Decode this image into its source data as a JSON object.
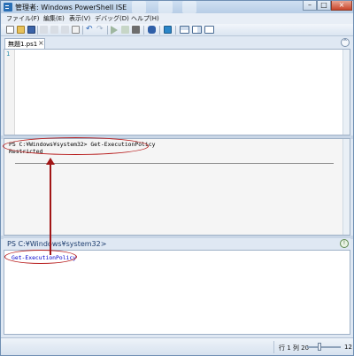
{
  "window": {
    "title": "管理者: Windows PowerShell ISE"
  },
  "menu": [
    "ファイル(F)",
    "編集(E)",
    "表示(V)",
    "デバッグ(D)",
    "ヘルプ(H)"
  ],
  "toolbar": {
    "icons": [
      "new-icon",
      "open-icon",
      "save-icon",
      "cut-icon",
      "copy-icon",
      "paste-icon",
      "clear-icon",
      "undo-icon",
      "redo-icon",
      "run-icon",
      "run-selection-icon",
      "stop-icon",
      "remote-icon",
      "powershell-icon",
      "layout-top-icon",
      "layout-right-icon",
      "layout-max-icon"
    ],
    "colors": {
      "run": "#3a9a3a",
      "stop": "#3a3a3a",
      "undo": "#2a66b8",
      "accent": "#2a6fb5"
    }
  },
  "script_tab": {
    "label": "無題1.ps1",
    "close": "×"
  },
  "editor": {
    "line_number": "1"
  },
  "output": {
    "line1": "PS C:¥Windows¥system32> Get-ExecutionPolicy",
    "line2": "Restricted"
  },
  "console": {
    "prompt": "PS C:¥Windows¥system32>",
    "input": "Get-ExecutionPolicy"
  },
  "status": {
    "position": "行 1 列 20",
    "zoom": "12"
  },
  "annotation_color": "#b71c1c"
}
